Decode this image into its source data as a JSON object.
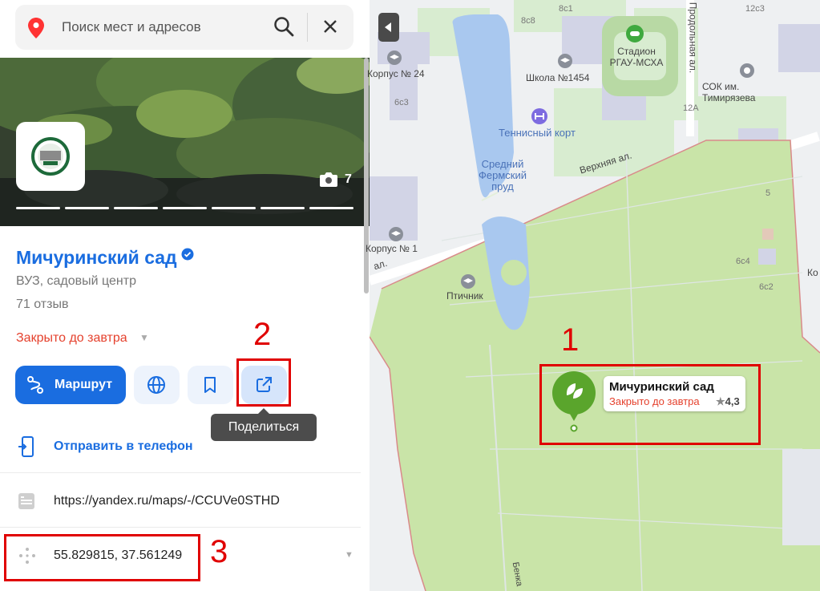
{
  "search": {
    "placeholder": "Поиск мест и адресов"
  },
  "photos": {
    "count": "7"
  },
  "place": {
    "name": "Мичуринский сад",
    "category": "ВУЗ, садовый центр",
    "reviews": "71 отзыв",
    "status": "Закрыто до завтра"
  },
  "actions": {
    "route_label": "Маршрут",
    "share_tooltip": "Поделиться"
  },
  "rows": {
    "send_to_phone": "Отправить в телефон",
    "link": "https://yandex.ru/maps/-/CCUVe0STHD",
    "coords": "55.829815, 37.561249"
  },
  "annotations": [
    "1",
    "2",
    "3"
  ],
  "map": {
    "labels": {
      "korpus24": "Корпус № 24",
      "korpus1": "Корпус № 1",
      "school": "Школа №1454",
      "stadium": "Стадион РГАУ-МСХА",
      "tennis": "Теннисный корт",
      "pond": "Средний Фермский пруд",
      "verkhnyaya": "Верхняя ал.",
      "prodolnaya": "Продольная ал.",
      "sok": "СОК им. Тимирязева",
      "ptichnik": "Птичник",
      "b6c3": "6с3",
      "b8c8": "8с8",
      "b8c1": "8с1",
      "b12c3": "12с3",
      "b12a": "12А",
      "b5": "5",
      "b6c4": "6с4",
      "b6c2": "6с2",
      "ko": "Ко",
      "al": "ал.",
      "benka": "Бенка"
    },
    "card": {
      "name": "Мичуринский сад",
      "status": "Закрыто до завтра",
      "rating": "4,3"
    }
  },
  "colors": {
    "accent": "#1a6de0",
    "closed": "#e5412d",
    "annotation": "#e00000",
    "park": "#c9e4a8",
    "pin": "#5aa52c"
  }
}
